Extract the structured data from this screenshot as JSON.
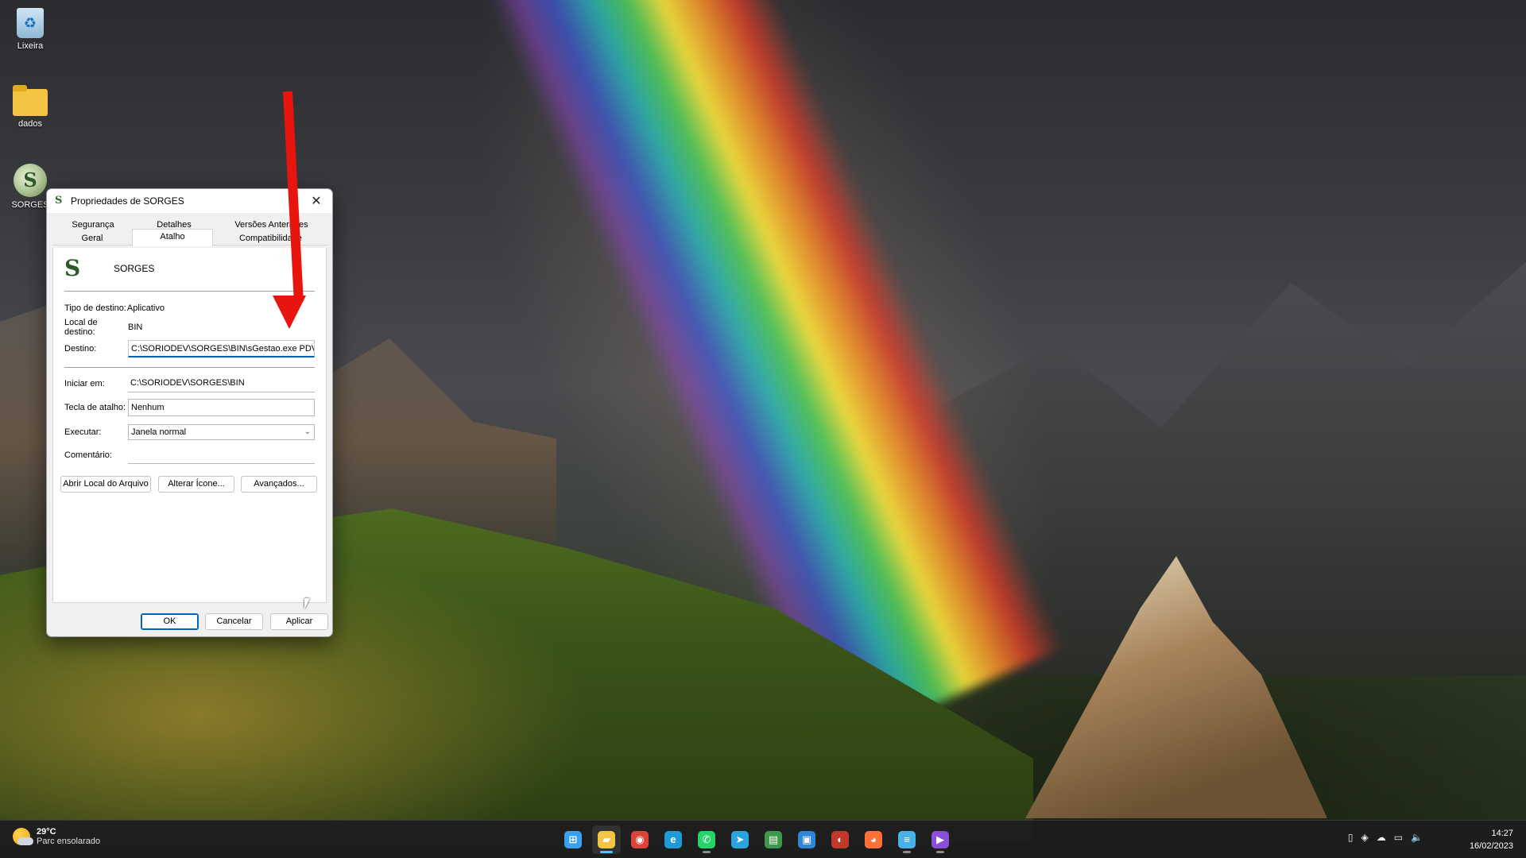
{
  "desktop": {
    "icons": [
      {
        "label": "Lixeira",
        "icon": "recycle-bin-icon"
      },
      {
        "label": "dados",
        "icon": "folder-icon"
      },
      {
        "label": "SORGES",
        "icon": "sorges-app-icon"
      }
    ]
  },
  "dialog": {
    "title": "Propriedades de SORGES",
    "tabs_row1": [
      "Segurança",
      "Detalhes",
      "Versões Anteriores"
    ],
    "tabs_row2": [
      "Geral",
      "Atalho",
      "Compatibilidade"
    ],
    "active_tab": "Atalho",
    "app_name": "SORGES",
    "fields": {
      "tipo_label": "Tipo de destino:",
      "tipo_value": "Aplicativo",
      "local_label": "Local de destino:",
      "local_value": "BIN",
      "destino_label": "Destino:",
      "destino_value": "C:\\SORIODEV\\SORGES\\BIN\\sGestao.exe PDV",
      "iniciar_label": "Iniciar em:",
      "iniciar_value": "C:\\SORIODEV\\SORGES\\BIN",
      "tecla_label": "Tecla de atalho:",
      "tecla_value": "Nenhum",
      "executar_label": "Executar:",
      "executar_value": "Janela normal",
      "comentario_label": "Comentário:",
      "comentario_value": ""
    },
    "buttons": {
      "abrir_local": "Abrir Local do Arquivo",
      "alterar_icone": "Alterar Ícone...",
      "avancados": "Avançados...",
      "ok": "OK",
      "cancelar": "Cancelar",
      "aplicar": "Aplicar"
    }
  },
  "taskbar": {
    "weather_temp": "29°C",
    "weather_desc": "Parc ensolarado",
    "apps": [
      {
        "name": "start",
        "icon": "windows-start-icon",
        "color": "#3aa0f3"
      },
      {
        "name": "explorer",
        "icon": "file-explorer-icon",
        "color": "#f4c542"
      },
      {
        "name": "chrome",
        "icon": "chrome-icon",
        "color": "#db4437"
      },
      {
        "name": "edge",
        "icon": "edge-icon",
        "color": "#1e9bd7"
      },
      {
        "name": "whatsapp",
        "icon": "whatsapp-icon",
        "color": "#25d366"
      },
      {
        "name": "telegram",
        "icon": "telegram-icon",
        "color": "#2aa3df"
      },
      {
        "name": "sheet",
        "icon": "spreadsheet-icon",
        "color": "#3c9a4a"
      },
      {
        "name": "app-blue",
        "icon": "app-blue-icon",
        "color": "#2f86d6"
      },
      {
        "name": "app-red",
        "icon": "app-red-icon",
        "color": "#c0392b"
      },
      {
        "name": "firefox",
        "icon": "firefox-icon",
        "color": "#ff7139"
      },
      {
        "name": "notepad",
        "icon": "notepad-icon",
        "color": "#4ab0e8"
      },
      {
        "name": "clipchamp",
        "icon": "video-editor-icon",
        "color": "#8a4fd8"
      }
    ],
    "time": "14:27",
    "date": "16/02/2023"
  }
}
